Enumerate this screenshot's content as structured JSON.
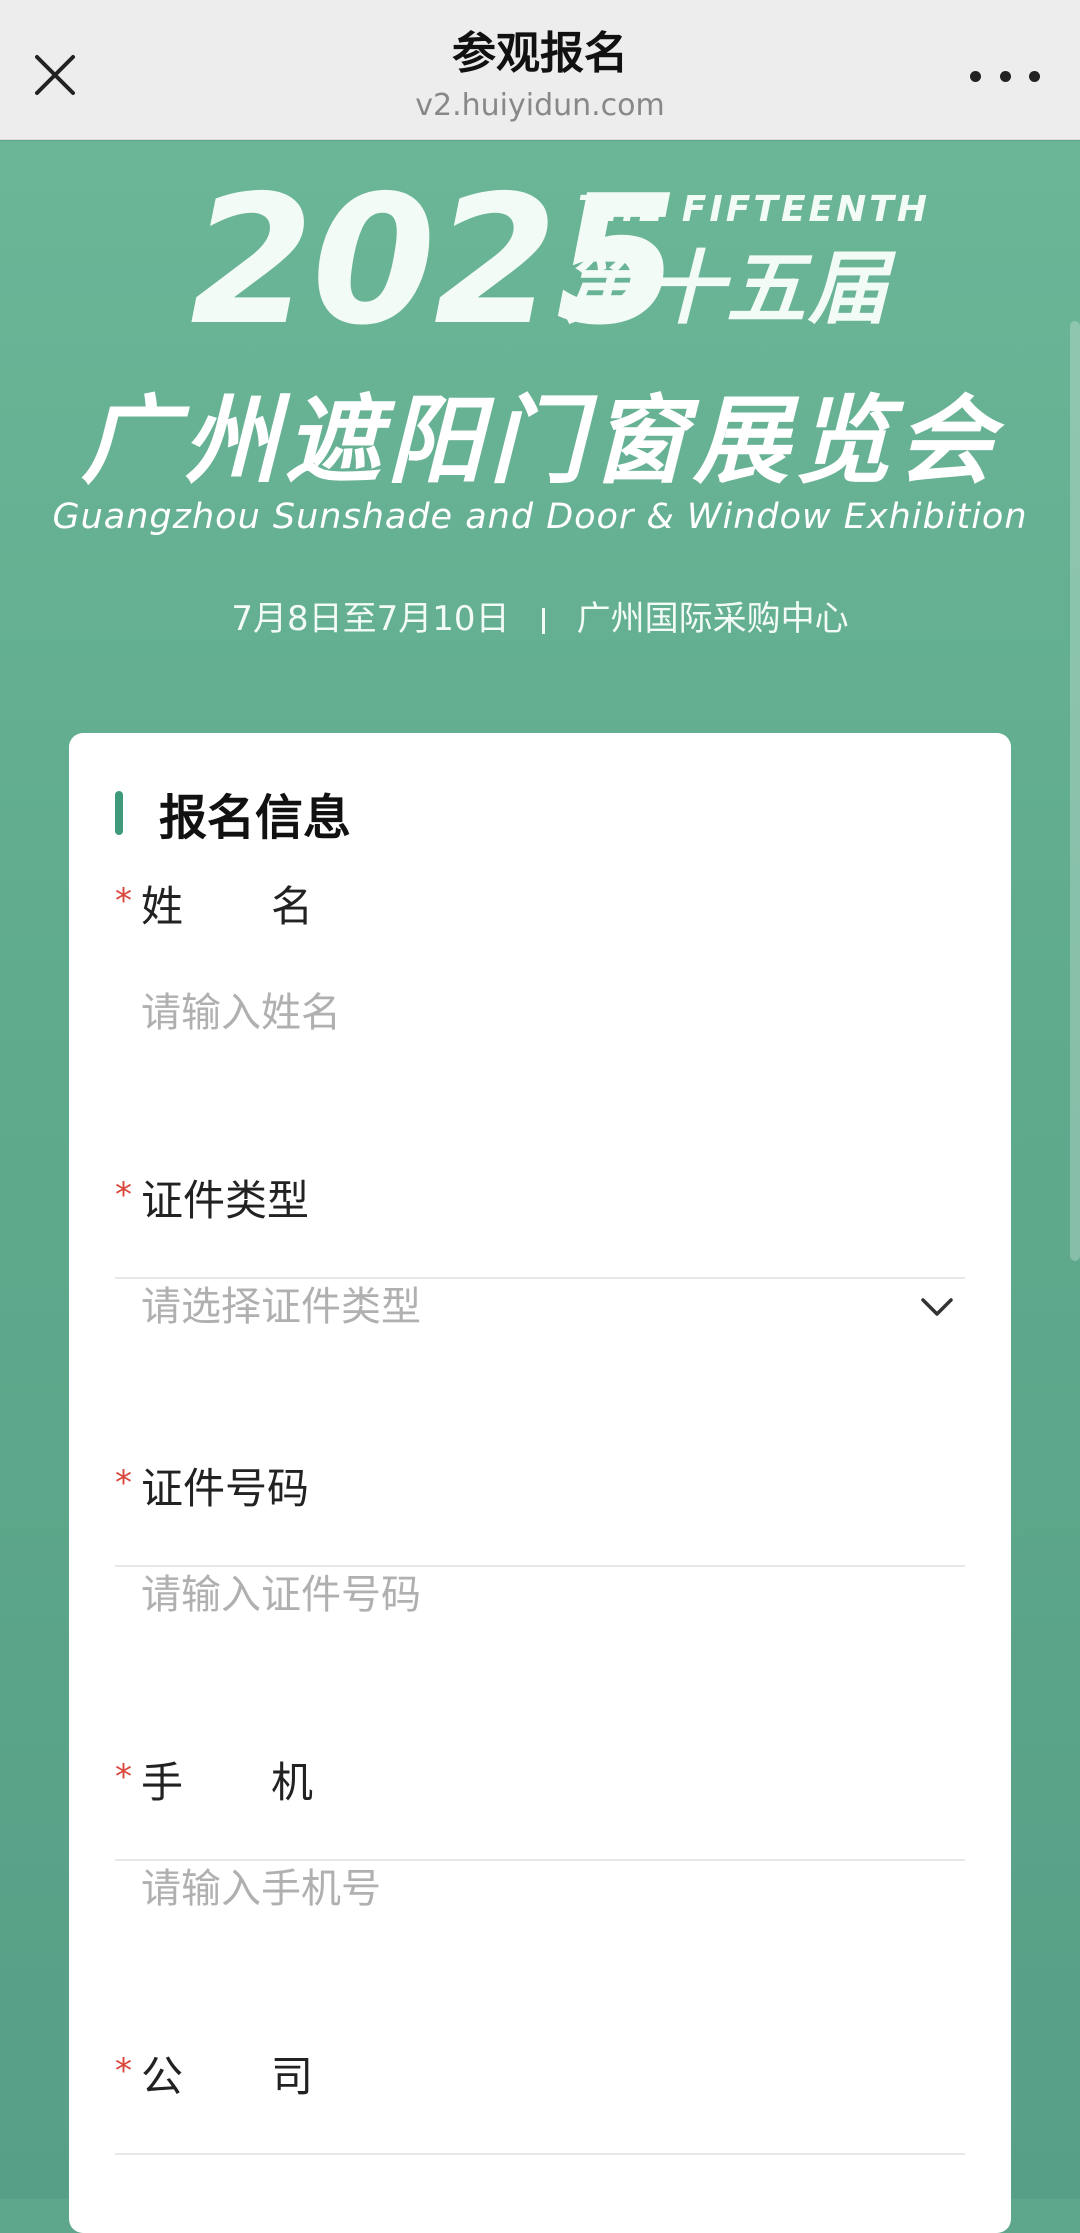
{
  "navbar": {
    "title": "参观报名",
    "url": "v2.huiyidun.com"
  },
  "banner": {
    "year": "2025",
    "edition_en": "THE FIFTEENTH",
    "edition_cn": "第十五届",
    "expo_name_cn": "广州遮阳门窗展览会",
    "expo_name_en": "Guangzhou Sunshade and Door & Window Exhibition",
    "dates": "7月8日至7月10日",
    "venue": "广州国际采购中心"
  },
  "form": {
    "section_title": "报名信息",
    "required_mark": "*",
    "fields": {
      "name": {
        "label_char1": "姓",
        "label_char2": "名",
        "placeholder": "请输入姓名"
      },
      "id_type": {
        "label": "证件类型",
        "placeholder": "请选择证件类型"
      },
      "id_number": {
        "label": "证件号码",
        "placeholder": "请输入证件号码"
      },
      "phone": {
        "label_char1": "手",
        "label_char2": "机",
        "placeholder": "请输入手机号"
      },
      "company": {
        "label_char1": "公",
        "label_char2": "司"
      }
    }
  },
  "colors": {
    "accent": "#3f9a7c",
    "required": "#d9463b",
    "background": "#5fa78c"
  }
}
